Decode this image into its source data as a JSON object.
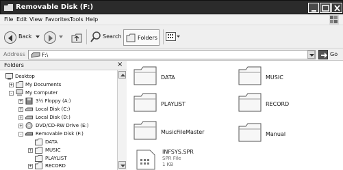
{
  "window": {
    "title": "Removable Disk (F:)"
  },
  "menu": [
    "File",
    "Edit",
    "View",
    "Favorites",
    "Tools",
    "Help"
  ],
  "toolbar": {
    "back_label": "Back",
    "search_label": "Search",
    "folders_label": "Folders"
  },
  "address": {
    "label": "Address",
    "value": "F:\\",
    "go_label": "Go"
  },
  "folders_panel": {
    "title": "Folders",
    "tree": [
      {
        "label": "Desktop",
        "icon": "desktop-icon",
        "expander": ""
      },
      {
        "label": "My Documents",
        "icon": "my-documents-icon",
        "expander": "+"
      },
      {
        "label": "My Computer",
        "icon": "my-computer-icon",
        "expander": "-"
      },
      {
        "label": "3½ Floppy (A:)",
        "icon": "floppy-icon",
        "expander": "+"
      },
      {
        "label": "Local Disk (C:)",
        "icon": "drive-icon",
        "expander": "+"
      },
      {
        "label": "Local Disk (D:)",
        "icon": "drive-icon",
        "expander": "+"
      },
      {
        "label": "DVD/CD-RW Drive (E:)",
        "icon": "dvd-drive-icon",
        "expander": "+"
      },
      {
        "label": "Removable Disk (F:)",
        "icon": "removable-disk-icon",
        "expander": "-"
      },
      {
        "label": "DATA",
        "icon": "folder-icon",
        "expander": ""
      },
      {
        "label": "MUSIC",
        "icon": "folder-icon",
        "expander": "+"
      },
      {
        "label": "PLAYLIST",
        "icon": "folder-icon",
        "expander": ""
      },
      {
        "label": "RECORD",
        "icon": "folder-icon",
        "expander": "+"
      }
    ]
  },
  "content": {
    "folders": [
      "DATA",
      "MUSIC",
      "PLAYLIST",
      "RECORD",
      "MusicFileMaster",
      "Manual"
    ],
    "file": {
      "name": "INFSYS.SPR",
      "type": "SPR File",
      "size": "1 KB"
    }
  }
}
